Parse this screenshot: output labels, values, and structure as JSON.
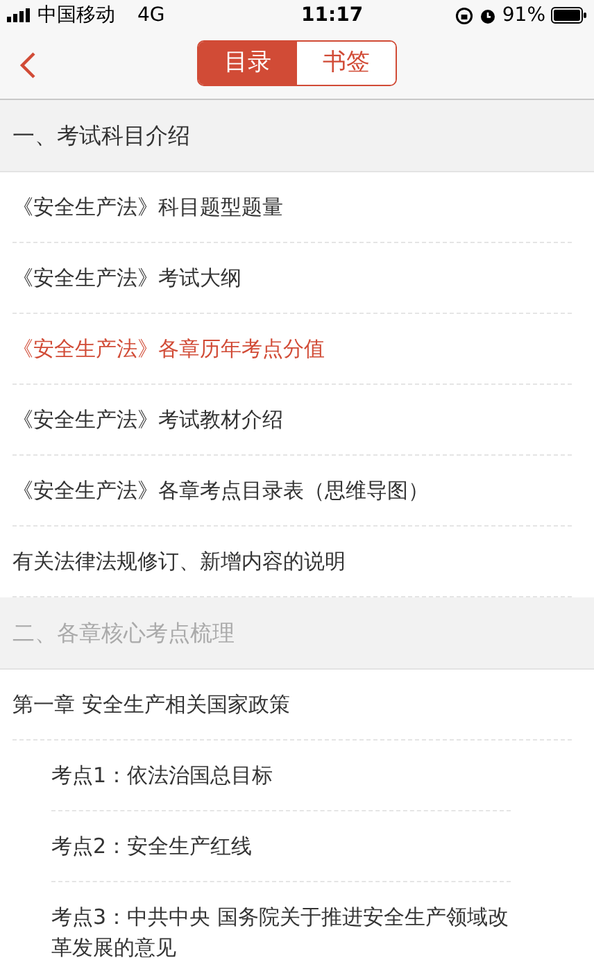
{
  "status_bar": {
    "carrier": "中国移动",
    "network": "4G",
    "time": "11:17",
    "battery": "91%"
  },
  "tabs": [
    {
      "label": "目录",
      "selected": true
    },
    {
      "label": "书签",
      "selected": false
    }
  ],
  "sections": [
    {
      "title": "一、考试科目介绍",
      "dimmed": false,
      "items": [
        {
          "text": "《安全生产法》科目题型题量",
          "selected": false
        },
        {
          "text": "《安全生产法》考试大纲",
          "selected": false
        },
        {
          "text": "《安全生产法》各章历年考点分值",
          "selected": true
        },
        {
          "text": "《安全生产法》考试教材介绍",
          "selected": false
        },
        {
          "text": "《安全生产法》各章考点目录表（思维导图）",
          "selected": false
        },
        {
          "text": "有关法律法规修订、新增内容的说明",
          "selected": false
        }
      ]
    },
    {
      "title": "二、各章核心考点梳理",
      "dimmed": true,
      "items": [
        {
          "text": "第一章 安全生产相关国家政策",
          "selected": false,
          "children": [
            {
              "text": "考点1：依法治国总目标",
              "selected": false
            },
            {
              "text": "考点2：安全生产红线",
              "selected": false
            },
            {
              "text": "考点3：中共中央 国务院关于推进安全生产领域改革发展的意见",
              "selected": false
            }
          ]
        }
      ]
    }
  ]
}
